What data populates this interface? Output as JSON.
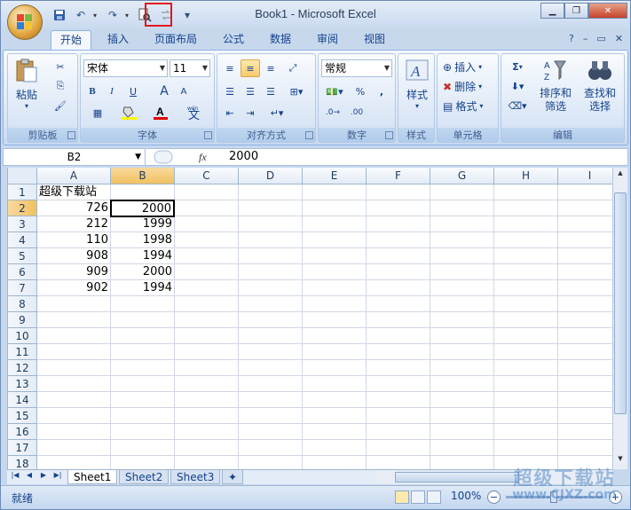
{
  "window": {
    "title": "Book1 - Microsoft Excel"
  },
  "quick_access": {
    "save": "💾",
    "undo": "↶",
    "redo": "↷",
    "print_preview": "🔍",
    "extra": "⇄",
    "customize": "▾"
  },
  "window_controls": {
    "minimize": "▁",
    "restore": "❐",
    "close": "✕"
  },
  "ribbon_tabs": [
    "开始",
    "插入",
    "页面布局",
    "公式",
    "数据",
    "审阅",
    "视图"
  ],
  "ribbon_right": {
    "help": "?",
    "min": "–",
    "restore": "▭",
    "close": "✕"
  },
  "groups": {
    "clipboard": {
      "label": "剪贴板",
      "paste": "粘贴"
    },
    "font": {
      "label": "字体",
      "font_name": "宋体",
      "font_size": "11",
      "bold": "B",
      "italic": "I",
      "underline": "U",
      "grow": "A",
      "shrink": "A",
      "phonetic": "wén"
    },
    "alignment": {
      "label": "对齐方式"
    },
    "number": {
      "label": "数字",
      "format": "常规",
      "percent": "%",
      "comma": ",",
      "inc_dec": "←.0 .00",
      "dec_dec": ".00 →.0"
    },
    "styles": {
      "label": "样式",
      "styles_btn": "样式"
    },
    "cells": {
      "label": "单元格",
      "insert": "插入",
      "delete": "删除",
      "format": "格式"
    },
    "editing": {
      "label": "编辑",
      "sort_filter": "排序和\n筛选",
      "find_select": "查找和\n选择",
      "sum": "Σ"
    }
  },
  "formula_bar": {
    "name_box": "B2",
    "fx": "fx",
    "value": "2000"
  },
  "columns": [
    "A",
    "B",
    "C",
    "D",
    "E",
    "F",
    "G",
    "H",
    "I"
  ],
  "rows": [
    "1",
    "2",
    "3",
    "4",
    "5",
    "6",
    "7",
    "8",
    "9",
    "10",
    "11",
    "12",
    "13",
    "14",
    "15",
    "16",
    "17",
    "18"
  ],
  "cells": {
    "A1": "超级下载站",
    "A2": "726",
    "B2": "2000",
    "A3": "212",
    "B3": "1999",
    "A4": "110",
    "B4": "1998",
    "A5": "908",
    "B5": "1994",
    "A6": "909",
    "B6": "2000",
    "A7": "902",
    "B7": "1994"
  },
  "sheets": [
    "Sheet1",
    "Sheet2",
    "Sheet3"
  ],
  "status": {
    "ready": "就绪",
    "zoom": "100%"
  },
  "watermark": {
    "line1": "超级下载站",
    "line2": "www.CJXZ.com"
  },
  "colors": {
    "selected_header": "#f1c15f",
    "accent": "#15428b"
  }
}
